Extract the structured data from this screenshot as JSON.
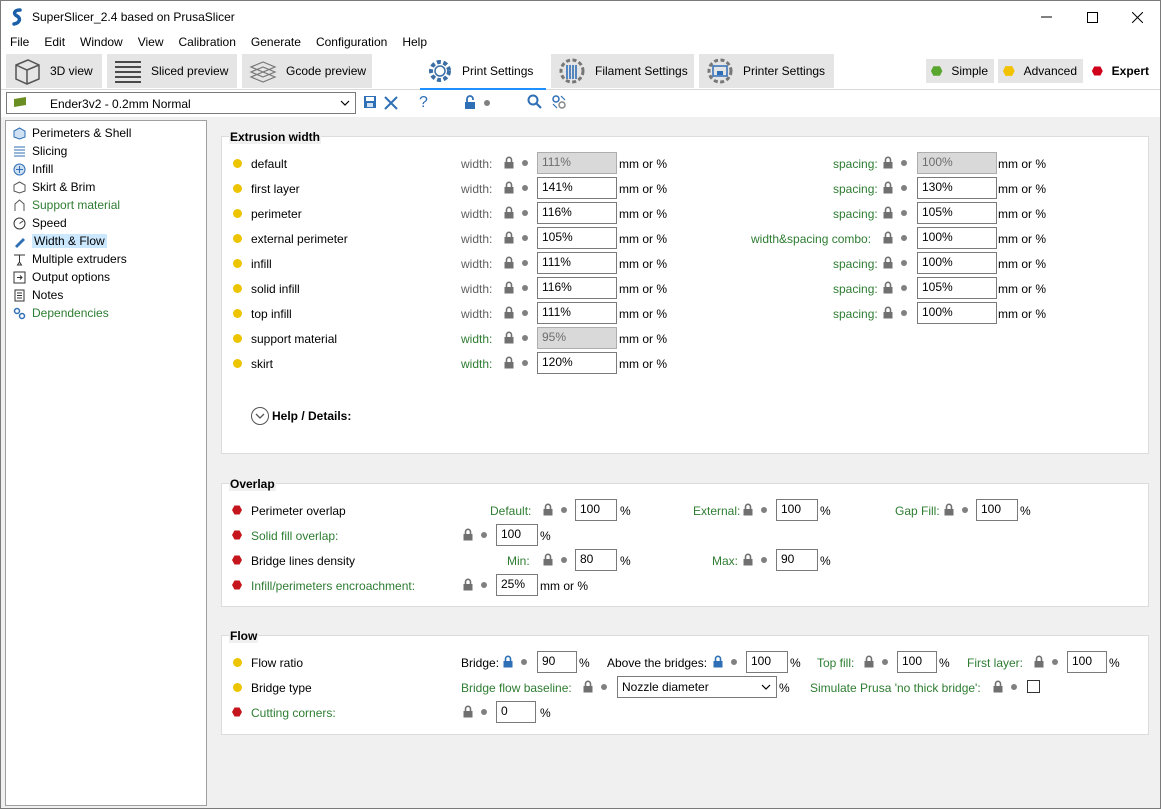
{
  "window": {
    "title": "SuperSlicer_2.4  based on PrusaSlicer"
  },
  "menu": [
    "File",
    "Edit",
    "Window",
    "View",
    "Calibration",
    "Generate",
    "Configuration",
    "Help"
  ],
  "tabs": {
    "view3d": "3D view",
    "sliced": "Sliced preview",
    "gcode": "Gcode preview",
    "print": "Print Settings",
    "filament": "Filament Settings",
    "printer": "Printer Settings"
  },
  "modes": {
    "simple": "Simple",
    "advanced": "Advanced",
    "expert": "Expert"
  },
  "preset": {
    "name": "Ender3v2 - 0.2mm Normal"
  },
  "sidebar": [
    {
      "label": "Perimeters & Shell",
      "icon": "shell-icon"
    },
    {
      "label": "Slicing",
      "icon": "slicing-icon"
    },
    {
      "label": "Infill",
      "icon": "infill-icon"
    },
    {
      "label": "Skirt & Brim",
      "icon": "skirt-icon"
    },
    {
      "label": "Support material",
      "icon": "support-icon"
    },
    {
      "label": "Speed",
      "icon": "speed-icon"
    },
    {
      "label": "Width & Flow",
      "icon": "width-flow-icon"
    },
    {
      "label": "Multiple extruders",
      "icon": "extruders-icon"
    },
    {
      "label": "Output options",
      "icon": "output-icon"
    },
    {
      "label": "Notes",
      "icon": "notes-icon"
    },
    {
      "label": "Dependencies",
      "icon": "dependencies-icon"
    }
  ],
  "extrusion": {
    "title": "Extrusion width",
    "width_label": "width:",
    "spacing_label": "spacing:",
    "combo_label": "width&spacing combo:",
    "unit": "mm or %",
    "rows": [
      {
        "label": "default",
        "width": "111%",
        "spacing": "100%"
      },
      {
        "label": "first layer",
        "width": "141%",
        "spacing": "130%"
      },
      {
        "label": "perimeter",
        "width": "116%",
        "spacing": "105%"
      },
      {
        "label": "external perimeter",
        "width": "105%",
        "spacing": "100%"
      },
      {
        "label": "infill",
        "width": "111%",
        "spacing": "100%"
      },
      {
        "label": "solid infill",
        "width": "116%",
        "spacing": "105%"
      },
      {
        "label": "top infill",
        "width": "111%",
        "spacing": "100%"
      },
      {
        "label": "support material",
        "width": "95%"
      },
      {
        "label": "skirt",
        "width": "120%"
      }
    ],
    "help": "Help / Details:"
  },
  "overlap": {
    "title": "Overlap",
    "perimeter_overlap": "Perimeter overlap",
    "default_label": "Default:",
    "default_val": "100",
    "external_label": "External:",
    "external_val": "100",
    "gapfill_label": "Gap Fill:",
    "gapfill_val": "100",
    "solid_fill": "Solid fill overlap:",
    "solid_val": "100",
    "bridge_density": "Bridge lines density",
    "min_label": "Min:",
    "min_val": "80",
    "max_label": "Max:",
    "max_val": "90",
    "encroach": "Infill/perimeters encroachment:",
    "encroach_val": "25%",
    "pct": "%",
    "mmpct": "mm or %"
  },
  "flow": {
    "title": "Flow",
    "ratio": "Flow ratio",
    "bridge_label": "Bridge:",
    "bridge_val": "90",
    "above_label": "Above the bridges:",
    "above_val": "100",
    "topfill_label": "Top fill:",
    "topfill_val": "100",
    "firstlayer_label": "First layer:",
    "firstlayer_val": "100",
    "bridge_type": "Bridge type",
    "baseline_label": "Bridge flow baseline:",
    "baseline_val": "Nozzle diameter",
    "simulate_label": "Simulate Prusa 'no thick bridge':",
    "cutting": "Cutting corners:",
    "cutting_val": "0",
    "pct": "%"
  }
}
